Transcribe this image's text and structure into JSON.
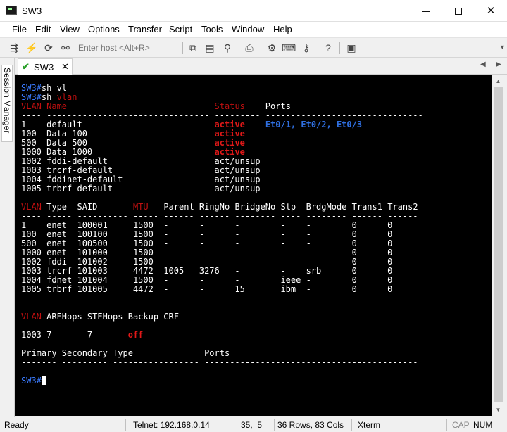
{
  "window": {
    "title": "SW3"
  },
  "menu": [
    "File",
    "Edit",
    "View",
    "Options",
    "Transfer",
    "Script",
    "Tools",
    "Window",
    "Help"
  ],
  "toolbar": {
    "host_placeholder": "Enter host <Alt+R>"
  },
  "sidebar": {
    "label": "Session Manager"
  },
  "tabs": [
    {
      "label": "SW3",
      "connected": true
    }
  ],
  "colors": {
    "prompt": "#3a7bff",
    "header": "#c01010",
    "ports": "#2f6fe0",
    "active": "#e01818"
  },
  "terminal": {
    "lines": [
      [
        {
          "t": "SW3#",
          "c": "p"
        },
        {
          "t": "sh vl"
        }
      ],
      [
        {
          "t": "SW3#",
          "c": "p"
        },
        {
          "t": "sh "
        },
        {
          "t": "vlan",
          "c": "r"
        }
      ],
      [
        {
          "t": "VLAN Name                             ",
          "c": "r"
        },
        {
          "t": "Status",
          "c": "r"
        },
        {
          "t": "    Ports"
        }
      ],
      [
        {
          "t": "---- -------------------------------- --------- -------------------------------"
        }
      ],
      [
        {
          "t": "1    default                          "
        },
        {
          "t": "active",
          "c": "a"
        },
        {
          "t": "    "
        },
        {
          "t": "Et0/1, Et0/2, Et0/3",
          "c": "b"
        }
      ],
      [
        {
          "t": "100  Data 100                         "
        },
        {
          "t": "active",
          "c": "a"
        }
      ],
      [
        {
          "t": "500  Data 500                         "
        },
        {
          "t": "active",
          "c": "a"
        }
      ],
      [
        {
          "t": "1000 Data 1000                        "
        },
        {
          "t": "active",
          "c": "a"
        }
      ],
      [
        {
          "t": "1002 fddi-default                     act/unsup"
        }
      ],
      [
        {
          "t": "1003 trcrf-default                    act/unsup"
        }
      ],
      [
        {
          "t": "1004 fddinet-default                  act/unsup"
        }
      ],
      [
        {
          "t": "1005 trbrf-default                    act/unsup"
        }
      ],
      [
        {
          "t": ""
        }
      ],
      [
        {
          "t": "VLAN",
          "c": "r"
        },
        {
          "t": " Type  SAID       "
        },
        {
          "t": "MTU",
          "c": "r"
        },
        {
          "t": "   Parent RingNo BridgeNo Stp  BrdgMode Trans1 Trans2"
        }
      ],
      [
        {
          "t": "---- ----- ---------- ----- ------ ------ -------- ---- -------- ------ ------"
        }
      ],
      [
        {
          "t": "1    enet  100001     1500  -      -      -        -    -        0      0"
        }
      ],
      [
        {
          "t": "100  enet  100100     1500  -      -      -        -    -        0      0"
        }
      ],
      [
        {
          "t": "500  enet  100500     1500  -      -      -        -    -        0      0"
        }
      ],
      [
        {
          "t": "1000 enet  101000     1500  -      -      -        -    -        0      0"
        }
      ],
      [
        {
          "t": "1002 fddi  101002     1500  -      -      -        -    -        0      0"
        }
      ],
      [
        {
          "t": "1003 trcrf 101003     4472  1005   3276   -        -    srb      0      0"
        }
      ],
      [
        {
          "t": "1004 fdnet 101004     1500  -      -      -        ieee -        0      0"
        }
      ],
      [
        {
          "t": "1005 trbrf 101005     4472  -      -      15       ibm  -        0      0"
        }
      ],
      [
        {
          "t": ""
        }
      ],
      [
        {
          "t": ""
        }
      ],
      [
        {
          "t": "VLAN",
          "c": "r"
        },
        {
          "t": " AREHops STEHops Backup CRF"
        }
      ],
      [
        {
          "t": "---- ------- ------- ----------"
        }
      ],
      [
        {
          "t": "1003 7       7       "
        },
        {
          "t": "off",
          "c": "a"
        }
      ],
      [
        {
          "t": ""
        }
      ],
      [
        {
          "t": "Primary Secondary Type              Ports"
        }
      ],
      [
        {
          "t": "------- --------- ----------------- ------------------------------------------"
        }
      ],
      [
        {
          "t": ""
        }
      ],
      [
        {
          "t": "SW3#",
          "c": "p"
        },
        {
          "t": "",
          "cursor": true
        }
      ]
    ]
  },
  "status": {
    "ready": "Ready",
    "connection": "Telnet: 192.168.0.14",
    "cursor": "35,  5",
    "size": "36 Rows, 83 Cols",
    "emulation": "Xterm",
    "cap": "CAP",
    "num": "NUM"
  }
}
